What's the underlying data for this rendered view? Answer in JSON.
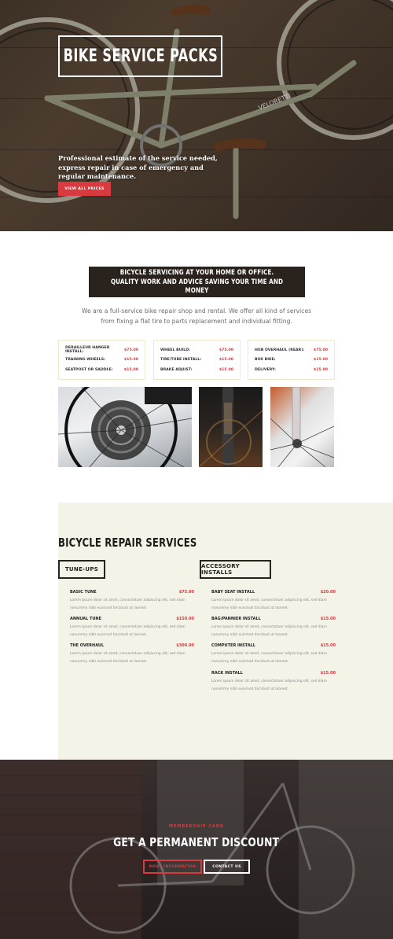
{
  "hero": {
    "title": "BIKE SERVICE PACKS",
    "description": "Professional estimate of the service needed, express repair in case of emergency and regular maintenance.",
    "button_label": "VIEW ALL PRICES",
    "frame_brand": "VELORETTI"
  },
  "intro": {
    "banner": "BICYCLE SERVICING AT YOUR HOME OR OFFICE. QUALITY WORK AND ADVICE SAVING YOUR TIME AND MONEY",
    "text": "We are a full-service bike repair shop and rental. We offer all kind of services from fixing a flat tire to parts replacement and individual fitting."
  },
  "price_cards": [
    {
      "rows": [
        {
          "label": "DERAILLEUR HANGER INSTALL:",
          "price": "$75.00"
        },
        {
          "label": "TRAINING WHEELS:",
          "price": "$15.00"
        },
        {
          "label": "SEATPOST OR SADDLE:",
          "price": "$15.00"
        }
      ]
    },
    {
      "rows": [
        {
          "label": "WHEEL BUILD:",
          "price": "$75.00"
        },
        {
          "label": "TIRE/TUBE INSTALL:",
          "price": "$15.00"
        },
        {
          "label": "BRAKE ADJUST:",
          "price": "$15.00"
        }
      ]
    },
    {
      "rows": [
        {
          "label": "HUB OVERHAUL (REAR):",
          "price": "$75.00"
        },
        {
          "label": "BOX BIKE:",
          "price": "$15.00"
        },
        {
          "label": "DELIVERY:",
          "price": "$15.00"
        }
      ]
    }
  ],
  "services": {
    "title": "BICYCLE REPAIR SERVICES",
    "tab_left": "TUNE-UPS",
    "tab_right": "ACCESSORY INSTALLS",
    "left": [
      {
        "name": "BASIC TUNE",
        "price": "$75.00",
        "desc": "Lorem ipsum dolor sit amet, consectetuer adipiscing elit, sed diam nonummy nibh euismod tincidunt ut laoreet."
      },
      {
        "name": "ANNUAL TUNE",
        "price": "$150.00",
        "desc": "Lorem ipsum dolor sit amet, consectetuer adipiscing elit, sed diam nonummy nibh euismod tincidunt ut laoreet."
      },
      {
        "name": "THE OVERHAUL",
        "price": "$300.00",
        "desc": "Lorem ipsum dolor sit amet, consectetuer adipiscing elit, sed diam nonummy nibh euismod tincidunt ut laoreet."
      }
    ],
    "right": [
      {
        "name": "BABY SEAT INSTALL",
        "price": "$20.00",
        "desc": "Lorem ipsum dolor sit amet, consectetuer adipiscing elit, sed diam nonummy nibh euismod tincidunt ut laoreet."
      },
      {
        "name": "BAG/PANNIER INSTALL",
        "price": "$15.00",
        "desc": "Lorem ipsum dolor sit amet, consectetuer adipiscing elit, sed diam nonummy nibh euismod tincidunt ut laoreet."
      },
      {
        "name": "COMPUTER INSTALL",
        "price": "$15.00",
        "desc": "Lorem ipsum dolor sit amet, consectetuer adipiscing elit, sed diam nonummy nibh euismod tincidunt ut laoreet."
      },
      {
        "name": "RACK INSTALL",
        "price": "$15.00",
        "desc": "Lorem ipsum dolor sit amet, consectetuer adipiscing elit, sed diam nonummy nibh euismod tincidunt ut laoreet."
      }
    ]
  },
  "cta": {
    "eyebrow": "MEMBERSHIP CARD",
    "title": "GET A PERMANENT DISCOUNT",
    "primary_label": "MORE INFORMATION",
    "secondary_label": "CONTACT US"
  },
  "colors": {
    "accent": "#d93a3f",
    "dark": "#2a221d",
    "cream": "#f4f3e8"
  }
}
